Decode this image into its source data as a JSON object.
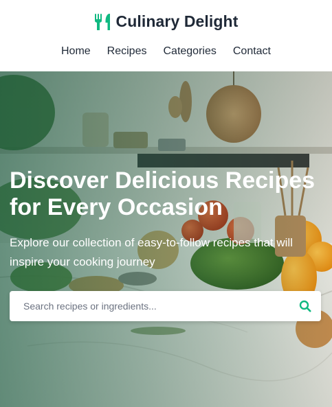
{
  "header": {
    "brand_name": "Culinary Delight",
    "brand_icon": "utensils-icon"
  },
  "nav": {
    "items": [
      {
        "label": "Home"
      },
      {
        "label": "Recipes"
      },
      {
        "label": "Categories"
      },
      {
        "label": "Contact"
      }
    ]
  },
  "hero": {
    "title": "Discover Delicious Recipes for Every Occasion",
    "subtitle": "Explore our collection of easy-to-follow recipes that will inspire your cooking journey",
    "background_image": "kitchen counter with vegetables and cookware"
  },
  "search": {
    "placeholder": "Search recipes or ingredients...",
    "value": "",
    "button_icon": "search-icon"
  },
  "colors": {
    "accent": "#10b981",
    "text_dark": "#1f2937",
    "overlay_green": "#14583e"
  }
}
